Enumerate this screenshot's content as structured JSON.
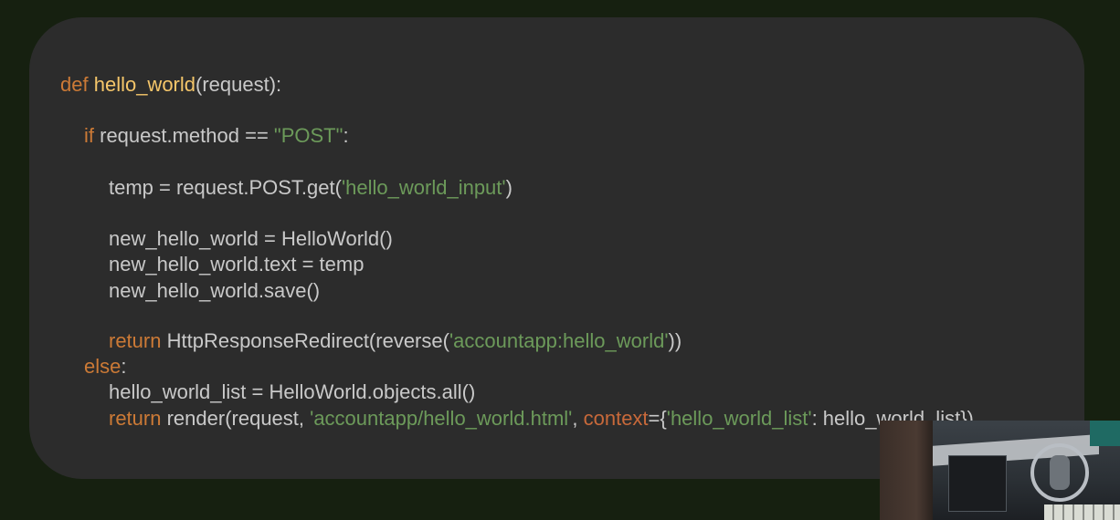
{
  "code": {
    "l1_kw": "def",
    "l1_sp": " ",
    "l1_fn": "hello_world",
    "l1_rest": "(request):",
    "l2_kw": "if",
    "l2_mid": " request.method == ",
    "l2_str": "\"POST\"",
    "l2_end": ":",
    "l3_a": "temp = request.POST.get(",
    "l3_str": "'hello_world_input'",
    "l3_b": ")",
    "l4": "new_hello_world = HelloWorld()",
    "l5": "new_hello_world.text = temp",
    "l6": "new_hello_world.save()",
    "l7_kw": "return",
    "l7_a": " HttpResponseRedirect(reverse(",
    "l7_str": "'accountapp:hello_world'",
    "l7_b": "))",
    "l8_kw": "else",
    "l8_end": ":",
    "l9": "hello_world_list = HelloWorld.objects.all()",
    "l10_kw": "return",
    "l10_a": " render(request, ",
    "l10_str": "'accountapp/hello_world.html'",
    "l10_b": ", ",
    "l10_param": "context",
    "l10_c": "={",
    "l10_str2": "'hello_world_list'",
    "l10_d": ": hello_world_list})"
  },
  "colors": {
    "background": "#162010",
    "card": "#2c2c2c",
    "text": "#c9c9c9",
    "keyword": "#cc7a36",
    "function": "#f5c66a",
    "string": "#6c9a5a",
    "parameter": "#c8693a"
  },
  "webcam": {
    "icon": "webcam-overlay"
  }
}
